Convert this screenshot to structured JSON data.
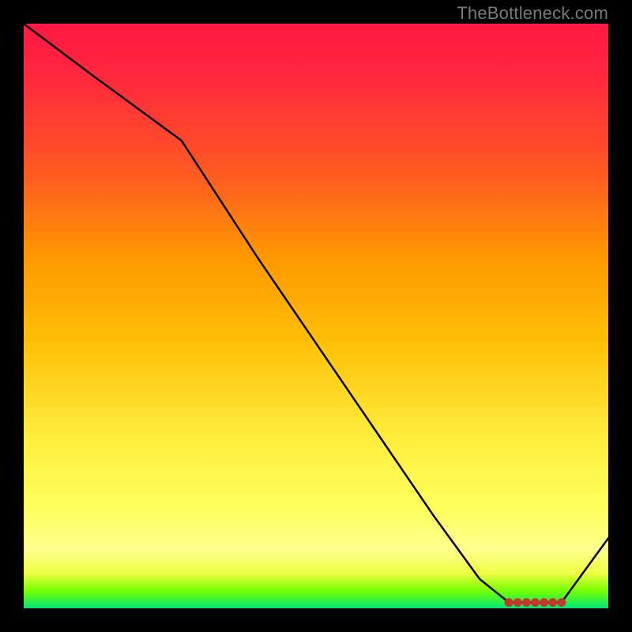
{
  "watermark": "TheBottleneck.com",
  "chart_data": {
    "type": "line",
    "title": "",
    "xlabel": "",
    "ylabel": "",
    "xlim": [
      0,
      100
    ],
    "ylim": [
      0,
      100
    ],
    "series": [
      {
        "name": "curve",
        "x": [
          0,
          12,
          27,
          40,
          55,
          70,
          78,
          83,
          88,
          92,
          100
        ],
        "values": [
          100,
          91,
          80,
          60,
          38,
          16,
          5,
          1,
          1,
          1,
          12
        ]
      }
    ],
    "markers": {
      "name": "bottom-cluster",
      "x": [
        83,
        84.5,
        86,
        87.5,
        89,
        90.5,
        92
      ],
      "values": [
        1,
        1,
        1,
        1,
        1,
        1,
        1
      ],
      "color": "#c0392b"
    },
    "gradient_stops": [
      {
        "pos": 0,
        "color": "#ff1744"
      },
      {
        "pos": 25,
        "color": "#ff5722"
      },
      {
        "pos": 55,
        "color": "#ffc107"
      },
      {
        "pos": 82,
        "color": "#ffff59"
      },
      {
        "pos": 97,
        "color": "#76ff03"
      },
      {
        "pos": 100,
        "color": "#00e676"
      }
    ]
  }
}
